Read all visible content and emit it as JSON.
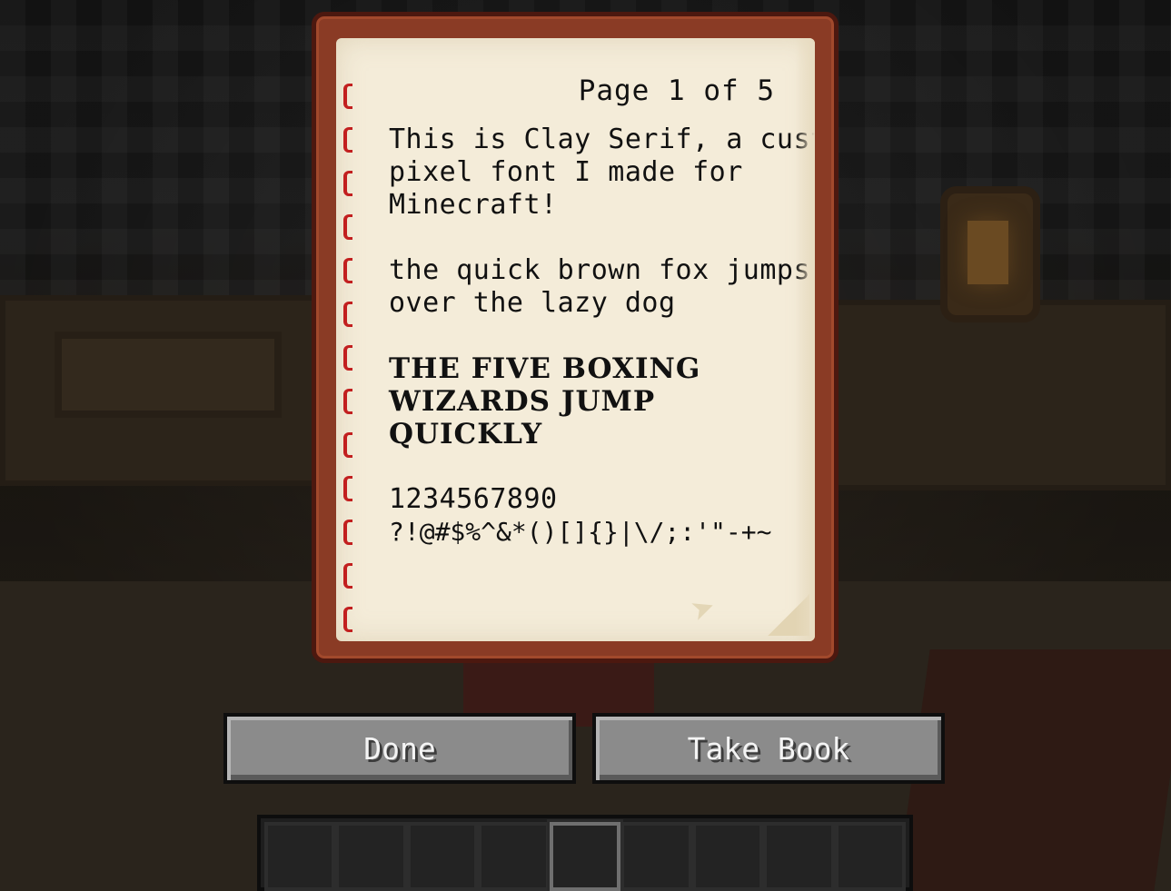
{
  "book": {
    "page_indicator": "Page 1 of 5",
    "lines": [
      "This is Clay Serif, a custom",
      "pixel font I made for",
      "Minecraft!",
      "",
      "the quick brown fox jumps",
      "over the lazy dog",
      "",
      "THE FIVE BOXING",
      "WIZARDS JUMP",
      "QUICKLY",
      "",
      "1234567890",
      "?!@#$%^&*()[]{}|\\/;:'\"-+~"
    ],
    "next_page_icon": "arrow-right",
    "colors": {
      "cover": "#8a3b25",
      "paper": "#f4ecd9",
      "stitching": "#c21f1f"
    }
  },
  "buttons": {
    "done_label": "Done",
    "take_book_label": "Take Book"
  },
  "hotbar": {
    "slot_count": 9,
    "selected_slot": 5
  }
}
